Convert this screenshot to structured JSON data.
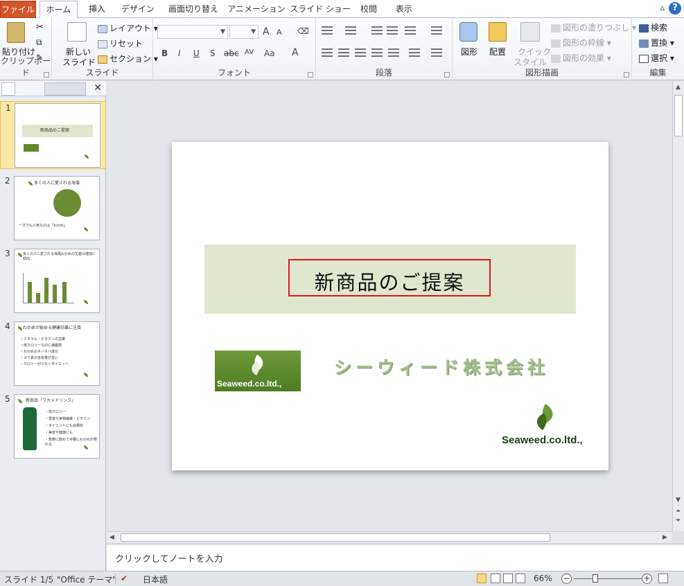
{
  "tabs": [
    "ファイル",
    "ホーム",
    "挿入",
    "デザイン",
    "画面切り替え",
    "アニメーション",
    "スライド ショー",
    "校閲",
    "表示"
  ],
  "active_tab": "ホーム",
  "help_label": "?",
  "ribbon": {
    "clipboard": {
      "label": "クリップボード",
      "paste": "貼り付け"
    },
    "slides": {
      "label": "スライド",
      "new_slide_1": "新しい",
      "new_slide_2": "スライド",
      "layout": "レイアウト",
      "reset": "リセット",
      "section": "セクション"
    },
    "font": {
      "label": "フォント",
      "bold": "B",
      "italic": "I",
      "underline": "U",
      "shadow": "S",
      "strike": "abc",
      "spacing": "AV",
      "case": "Aa",
      "color": "A",
      "grow": "A",
      "shrink": "A"
    },
    "paragraph": {
      "label": "段落"
    },
    "drawing": {
      "label": "図形描画",
      "shapes": "図形",
      "arrange": "配置",
      "quick_styles_1": "クイック",
      "quick_styles_2": "スタイル",
      "fill": "図形の塗りつぶし",
      "outline": "図形の枠線",
      "effects": "図形の効果"
    },
    "editing": {
      "label": "編集",
      "find": "検索",
      "replace": "置換",
      "select": "選択"
    }
  },
  "thumbnails": [
    {
      "num": "1",
      "title": "新商品のご提案"
    },
    {
      "num": "2",
      "title": "多くの人に愛される海藻",
      "line": "一才でも人気なのは「わかめ」"
    },
    {
      "num": "3",
      "title": "多くの人に愛される海藻わかめの生産は増加に傾向"
    },
    {
      "num": "4",
      "title": "わかめが秘める健康効果に注目",
      "bullets": [
        "・ミネラル・ビタミンの宝庫",
        "・低カロリーなのに満腹感",
        "・わかめのネバネバ成分",
        "・ヨウ素の含有量が多い",
        "・カロリーが少なくダイエット"
      ]
    },
    {
      "num": "5",
      "title": "新商品「ワカメドリンク」",
      "bullets": [
        "・低カロリー",
        "・豊富な食物繊維・ビタミン",
        "・ダイエットにも効果的",
        "・美容や健康にも",
        "・気軽に飲めて手軽にわかめが摂れる"
      ]
    }
  ],
  "slide": {
    "title": "新商品のご提案",
    "company": "シーウィード株式会社",
    "logo_text": "Seaweed.co.ltd.,"
  },
  "notes_placeholder": "クリックしてノートを入力",
  "status": {
    "slide": "スライド 1/5",
    "theme": "\"Office テーマ\"",
    "language": "日本語",
    "zoom": "66%"
  },
  "colors": {
    "file_tab": "#d35428",
    "accent_green": "#6f9a3a",
    "title_box_border": "#e1141d",
    "selected_thumb": "#fde7a6"
  }
}
